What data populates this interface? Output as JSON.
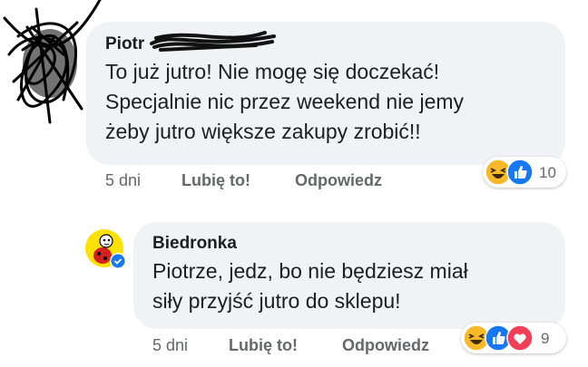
{
  "comments": [
    {
      "author": "Piotr",
      "text": "To już jutro! Nie mogę się doczekać!\nSpecjalnie nic przez weekend nie jemy\nżeby jutro większe zakupy zrobić!!",
      "time": "5 dni",
      "like_label": "Lubię to!",
      "reply_label": "Odpowiedz",
      "reaction_count": "10",
      "reactions": [
        "haha-icon",
        "like-icon"
      ]
    },
    {
      "author": "Biedronka",
      "text": "Piotrze, jedz, bo nie będziesz miał\nsiły przyjść jutro do sklepu!",
      "time": "5 dni",
      "like_label": "Lubię to!",
      "reply_label": "Odpowiedz",
      "reaction_count": "9",
      "reactions": [
        "haha-icon",
        "like-icon",
        "love-icon"
      ]
    }
  ],
  "colors": {
    "bubble": "#f1f2f5",
    "meta_text": "#65676b",
    "like_blue": "#1877f2",
    "love_red": "#f33e58",
    "haha_yellow": "#f7b928",
    "verified_blue": "#1877f2"
  }
}
